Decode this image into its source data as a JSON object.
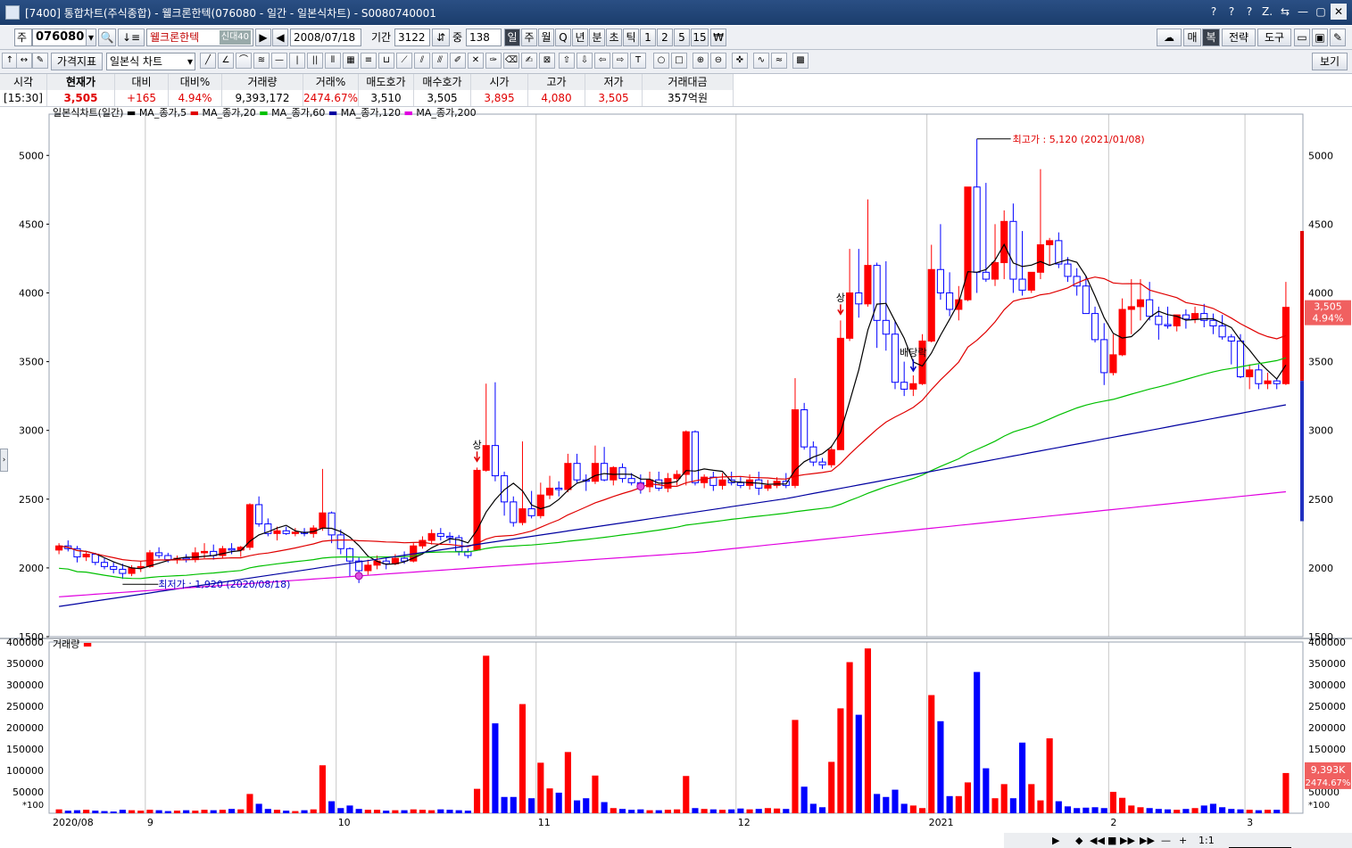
{
  "window": {
    "title": "[7400] 통합차트(주식종합) - 웰크론한텍(076080 - 일간 - 일본식차트) - S0080740001",
    "buttons": [
      "?",
      "?",
      "?",
      "Z.",
      "⇆",
      "—",
      "▢",
      "✕"
    ]
  },
  "toolbar1": {
    "market_label": "주",
    "code": "076080",
    "name": "웰크론한텍",
    "name_tags": "신대40",
    "date": "2008/07/18",
    "period_label": "기간",
    "period_value": "3122",
    "count_label": "중",
    "count_value": "138",
    "periods": [
      "일",
      "주",
      "월",
      "Q",
      "년",
      "분",
      "초",
      "틱",
      "1",
      "2",
      "5",
      "15",
      "₩"
    ],
    "selected_period": "일",
    "right_buttons": [
      "매",
      "복",
      "전략",
      "도구"
    ]
  },
  "toolbar2": {
    "indicator_button": "가격지표",
    "chart_type": "일본식 차트",
    "view_button": "보기"
  },
  "quote": {
    "headers": [
      "시각",
      "현재가",
      "대비",
      "대비%",
      "거래량",
      "거래%",
      "매도호가",
      "매수호가",
      "시가",
      "고가",
      "저가",
      "거래대금"
    ],
    "values": [
      "[15:30]",
      "3,505",
      "+165",
      "4.94%",
      "9,393,172",
      "2474.67%",
      "3,510",
      "3,505",
      "3,895",
      "4,080",
      "3,505",
      "357억원"
    ]
  },
  "price_legend": {
    "title": "일본식차트(일간)",
    "ma": [
      "MA_종가,5",
      "MA_종가,20",
      "MA_종가,60",
      "MA_종가,120",
      "MA_종가,200"
    ]
  },
  "volume_legend": "거래량",
  "annotations": {
    "high": "최고가 : 5,120 (2021/01/08)",
    "low": "최저가 : 1,920 (2020/08/18)",
    "upper_limit": "상",
    "dividend": "배당락",
    "price_badge": "3,505",
    "pct_badge": "4.94%",
    "vol_badge": "9,393K",
    "vol_pct_badge": "2474.67%",
    "unit": "*100"
  },
  "bottom_controls": [
    "▶",
    "◆",
    "◀◀",
    "■",
    "▶▶",
    "▶▶",
    "—",
    "+",
    "1:1"
  ],
  "colors": {
    "up": "#ff0000",
    "down": "#0000ff",
    "ma5": "#000000",
    "ma20": "#e00000",
    "ma60": "#00c000",
    "ma120": "#0000a0",
    "ma200": "#e000e0"
  },
  "chart_data": {
    "type": "candlestick",
    "price_axis": {
      "ticks": [
        1500,
        2000,
        2500,
        3000,
        3500,
        4000,
        4500,
        5000
      ],
      "range": [
        1500,
        5300
      ]
    },
    "volume_axis": {
      "ticks": [
        50000,
        100000,
        150000,
        200000,
        250000,
        300000,
        350000,
        400000
      ],
      "range": [
        0,
        400000
      ]
    },
    "x_labels": [
      "2020/08",
      "9",
      "10",
      "11",
      "12",
      "2021",
      "2",
      "3"
    ],
    "candles": [
      [
        2130,
        2180,
        2100,
        2160
      ],
      [
        2160,
        2200,
        2120,
        2140
      ],
      [
        2140,
        2160,
        2040,
        2080
      ],
      [
        2080,
        2120,
        2050,
        2100
      ],
      [
        2100,
        2110,
        2020,
        2040
      ],
      [
        2040,
        2070,
        1990,
        2010
      ],
      [
        2010,
        2040,
        1960,
        1990
      ],
      [
        1990,
        2030,
        1920,
        1960
      ],
      [
        1960,
        2020,
        1940,
        2000
      ],
      [
        2000,
        2050,
        1970,
        2010
      ],
      [
        2010,
        2130,
        2000,
        2110
      ],
      [
        2110,
        2150,
        2070,
        2090
      ],
      [
        2090,
        2110,
        2040,
        2060
      ],
      [
        2060,
        2090,
        2030,
        2070
      ],
      [
        2070,
        2100,
        2040,
        2060
      ],
      [
        2060,
        2150,
        2040,
        2110
      ],
      [
        2110,
        2180,
        2070,
        2120
      ],
      [
        2120,
        2170,
        2060,
        2090
      ],
      [
        2090,
        2160,
        2070,
        2140
      ],
      [
        2140,
        2180,
        2100,
        2130
      ],
      [
        2130,
        2160,
        2080,
        2150
      ],
      [
        2150,
        2470,
        2130,
        2460
      ],
      [
        2460,
        2520,
        2300,
        2320
      ],
      [
        2320,
        2360,
        2230,
        2250
      ],
      [
        2250,
        2300,
        2200,
        2270
      ],
      [
        2270,
        2300,
        2240,
        2250
      ],
      [
        2250,
        2290,
        2230,
        2260
      ],
      [
        2260,
        2290,
        2230,
        2250
      ],
      [
        2250,
        2310,
        2220,
        2290
      ],
      [
        2290,
        2720,
        2270,
        2400
      ],
      [
        2400,
        2410,
        2180,
        2240
      ],
      [
        2240,
        2280,
        2100,
        2140
      ],
      [
        2140,
        2150,
        1940,
        2050
      ],
      [
        2050,
        2080,
        1890,
        1980
      ],
      [
        1980,
        2060,
        1950,
        2020
      ],
      [
        2020,
        2090,
        1990,
        2050
      ],
      [
        2050,
        2080,
        1990,
        2030
      ],
      [
        2030,
        2100,
        2020,
        2070
      ],
      [
        2070,
        2120,
        2030,
        2050
      ],
      [
        2050,
        2180,
        2040,
        2160
      ],
      [
        2160,
        2230,
        2140,
        2200
      ],
      [
        2200,
        2280,
        2170,
        2250
      ],
      [
        2250,
        2290,
        2200,
        2230
      ],
      [
        2230,
        2260,
        2180,
        2220
      ],
      [
        2220,
        2240,
        2090,
        2120
      ],
      [
        2120,
        2140,
        2070,
        2090
      ],
      [
        2130,
        2730,
        2130,
        2710
      ],
      [
        2710,
        3340,
        2700,
        2890
      ],
      [
        2890,
        3350,
        2630,
        2670
      ],
      [
        2670,
        2700,
        2380,
        2480
      ],
      [
        2480,
        2520,
        2300,
        2330
      ],
      [
        2330,
        2920,
        2310,
        2430
      ],
      [
        2430,
        2560,
        2360,
        2380
      ],
      [
        2380,
        2620,
        2360,
        2530
      ],
      [
        2530,
        2670,
        2500,
        2580
      ],
      [
        2580,
        2630,
        2520,
        2570
      ],
      [
        2570,
        2830,
        2550,
        2760
      ],
      [
        2760,
        2830,
        2620,
        2640
      ],
      [
        2640,
        2680,
        2560,
        2630
      ],
      [
        2630,
        2890,
        2610,
        2760
      ],
      [
        2760,
        2880,
        2630,
        2640
      ],
      [
        2640,
        2740,
        2600,
        2730
      ],
      [
        2730,
        2760,
        2620,
        2650
      ],
      [
        2650,
        2690,
        2600,
        2620
      ],
      [
        2620,
        2680,
        2540,
        2590
      ],
      [
        2590,
        2700,
        2550,
        2640
      ],
      [
        2640,
        2700,
        2560,
        2580
      ],
      [
        2580,
        2690,
        2550,
        2650
      ],
      [
        2650,
        2710,
        2600,
        2680
      ],
      [
        2680,
        3000,
        2600,
        2990
      ],
      [
        2990,
        3000,
        2600,
        2620
      ],
      [
        2620,
        2680,
        2580,
        2660
      ],
      [
        2660,
        2700,
        2560,
        2600
      ],
      [
        2600,
        2690,
        2570,
        2640
      ],
      [
        2640,
        2700,
        2600,
        2620
      ],
      [
        2620,
        2660,
        2580,
        2600
      ],
      [
        2600,
        2680,
        2570,
        2640
      ],
      [
        2640,
        2700,
        2530,
        2580
      ],
      [
        2580,
        2640,
        2560,
        2600
      ],
      [
        2600,
        2660,
        2580,
        2630
      ],
      [
        2630,
        2690,
        2580,
        2600
      ],
      [
        2600,
        3380,
        2580,
        3150
      ],
      [
        3150,
        3200,
        2860,
        2880
      ],
      [
        2880,
        2920,
        2740,
        2770
      ],
      [
        2770,
        2800,
        2720,
        2750
      ],
      [
        2750,
        2890,
        2730,
        2860
      ],
      [
        2860,
        3800,
        2860,
        3670
      ],
      [
        3670,
        4320,
        3650,
        4000
      ],
      [
        4000,
        4320,
        3820,
        3920
      ],
      [
        3920,
        4680,
        3900,
        4200
      ],
      [
        4200,
        4220,
        3600,
        3800
      ],
      [
        3800,
        4230,
        3580,
        3700
      ],
      [
        3700,
        3800,
        3300,
        3350
      ],
      [
        3350,
        3500,
        3250,
        3300
      ],
      [
        3300,
        3400,
        3250,
        3340
      ],
      [
        3340,
        3700,
        3330,
        3650
      ],
      [
        3650,
        4350,
        3640,
        4170
      ],
      [
        4170,
        4500,
        3950,
        4000
      ],
      [
        4000,
        4150,
        3830,
        3880
      ],
      [
        3880,
        4050,
        3800,
        3950
      ],
      [
        3950,
        4760,
        3940,
        4770
      ],
      [
        4770,
        5120,
        4000,
        4150
      ],
      [
        4150,
        4800,
        4080,
        4100
      ],
      [
        4100,
        4500,
        4050,
        4220
      ],
      [
        4220,
        4600,
        4100,
        4520
      ],
      [
        4520,
        4650,
        4000,
        4100
      ],
      [
        4100,
        4450,
        3980,
        4020
      ],
      [
        4020,
        4150,
        4000,
        4150
      ],
      [
        4150,
        4900,
        4100,
        4350
      ],
      [
        4350,
        4400,
        4200,
        4380
      ],
      [
        4380,
        4440,
        4180,
        4210
      ],
      [
        4210,
        4260,
        4080,
        4120
      ],
      [
        4120,
        4180,
        3980,
        4050
      ],
      [
        4050,
        4120,
        3900,
        3850
      ],
      [
        3850,
        3900,
        3640,
        3660
      ],
      [
        3660,
        3780,
        3330,
        3420
      ],
      [
        3420,
        3700,
        3400,
        3550
      ],
      [
        3550,
        3960,
        3540,
        3880
      ],
      [
        3880,
        4100,
        3700,
        3900
      ],
      [
        3900,
        4100,
        3800,
        3950
      ],
      [
        3950,
        4080,
        3800,
        3830
      ],
      [
        3830,
        3900,
        3660,
        3770
      ],
      [
        3770,
        3900,
        3740,
        3760
      ],
      [
        3760,
        3840,
        3720,
        3840
      ],
      [
        3840,
        3880,
        3740,
        3810
      ],
      [
        3810,
        3900,
        3780,
        3850
      ],
      [
        3850,
        3920,
        3750,
        3800
      ],
      [
        3800,
        3850,
        3700,
        3760
      ],
      [
        3760,
        3840,
        3660,
        3680
      ],
      [
        3680,
        3700,
        3480,
        3650
      ],
      [
        3650,
        3700,
        3380,
        3390
      ],
      [
        3390,
        3480,
        3300,
        3440
      ],
      [
        3440,
        3480,
        3300,
        3340
      ],
      [
        3340,
        3420,
        3300,
        3360
      ],
      [
        3360,
        3380,
        3300,
        3340
      ],
      [
        3340,
        4080,
        3330,
        3895
      ]
    ],
    "volumes": [
      9000,
      6000,
      7000,
      8000,
      6000,
      5000,
      4000,
      8000,
      7000,
      6000,
      8000,
      7000,
      5000,
      6000,
      7000,
      6000,
      8000,
      7000,
      8000,
      10000,
      9000,
      45000,
      22000,
      10000,
      8000,
      6000,
      5000,
      7000,
      9000,
      112000,
      28000,
      12000,
      18000,
      10000,
      8000,
      8000,
      6000,
      7000,
      7000,
      9000,
      8000,
      7000,
      9000,
      8000,
      7000,
      6000,
      57000,
      368000,
      210000,
      38000,
      38000,
      255000,
      35000,
      118000,
      58000,
      48000,
      143000,
      30000,
      35000,
      88000,
      26000,
      12000,
      10000,
      8000,
      9000,
      7000,
      7000,
      8000,
      9000,
      87000,
      12000,
      10000,
      9000,
      8000,
      9000,
      11000,
      9000,
      10000,
      12000,
      11000,
      10000,
      218000,
      62000,
      22000,
      14000,
      120000,
      245000,
      353000,
      230000,
      385000,
      45000,
      38000,
      55000,
      22000,
      18000,
      12000,
      276000,
      215000,
      40000,
      40000,
      72000,
      330000,
      105000,
      35000,
      68000,
      35000,
      165000,
      68000,
      30000,
      175000,
      28000,
      16000,
      12000,
      13000,
      14000,
      12000,
      50000,
      36000,
      18000,
      14000,
      12000,
      10000,
      9000,
      8000,
      10000,
      12000,
      18000,
      22000,
      14000,
      10000,
      9000,
      8000,
      7000,
      8000,
      8000,
      93932
    ]
  }
}
